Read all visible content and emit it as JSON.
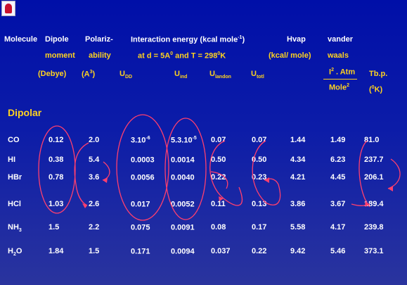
{
  "header": {
    "row1": {
      "molecule": "Molecule",
      "dipole": "Dipole",
      "polariz": "Polariz-",
      "interaction": "Interaction energy (kcal mole",
      "interaction_exp": "-1",
      "interaction_close": ")",
      "hvap": "Hvap",
      "vander": "vander"
    },
    "row2": {
      "moment": "moment",
      "ability": "ability",
      "at_d": "at d = 5A",
      "at_d_sup": "0",
      "and_t": " and T = 298",
      "and_t_sup": "0",
      "kelvin": "K",
      "kcal_mole": "(kcal/ mole)",
      "waals": "waals"
    },
    "row3": {
      "debye": "(Debye)",
      "a3": "(A",
      "a3_sup": "3",
      "a3_close": ")",
      "u": "U",
      "udd_sub": "DD",
      "uind_sub": "ind",
      "ulandon_sub": "landon",
      "utotl_sub": "totl",
      "frac_num": "I",
      "frac_num_sup": "2",
      "frac_num_rest": " . Atm",
      "frac_den": "Mole",
      "frac_den_sup": "2",
      "tbp": "Tb.p.",
      "tbp_unit_open": "(",
      "tbp_unit_sup": "0",
      "tbp_unit_rest": "K)"
    }
  },
  "section_title": "Dipolar",
  "rows": [
    {
      "molecule": "CO",
      "mol_sub": "",
      "mol_rest": "",
      "dipole": "0.12",
      "polar": "2.0",
      "udd": "3.10",
      "udd_sup": "-6",
      "uind": "5.3.10",
      "uind_sup": "-5",
      "ulandon": "0.07",
      "utotl": "0.07",
      "hvap": "1.44",
      "vdw": "1.49",
      "tbp": "81.0"
    },
    {
      "molecule": "HI",
      "mol_sub": "",
      "mol_rest": "",
      "dipole": "0.38",
      "polar": "5.4",
      "udd": "0.0003",
      "udd_sup": "",
      "uind": "0.0014",
      "uind_sup": "",
      "ulandon": "0.50",
      "utotl": "0.50",
      "hvap": "4.34",
      "vdw": "6.23",
      "tbp": "237.7"
    },
    {
      "molecule": "HBr",
      "mol_sub": "",
      "mol_rest": "",
      "dipole": "0.78",
      "polar": "3.6",
      "udd": "0.0056",
      "udd_sup": "",
      "uind": "0.0040",
      "uind_sup": "",
      "ulandon": "0.22",
      "utotl": "0.23",
      "hvap": "4.21",
      "vdw": "4.45",
      "tbp": "206.1"
    },
    {
      "molecule": "HCl",
      "mol_sub": "",
      "mol_rest": "",
      "dipole": "1.03",
      "polar": "2.6",
      "udd": "0.017",
      "udd_sup": "",
      "uind": "0.0052",
      "uind_sup": "",
      "ulandon": "0.11",
      "utotl": "0.13",
      "hvap": "3.86",
      "vdw": "3.67",
      "tbp": "189.4"
    },
    {
      "molecule": "NH",
      "mol_sub": "3",
      "mol_rest": "",
      "dipole": "1.5",
      "polar": "2.2",
      "udd": "0.075",
      "udd_sup": "",
      "uind": "0.0091",
      "uind_sup": "",
      "ulandon": "0.08",
      "utotl": "0.17",
      "hvap": "5.58",
      "vdw": "4.17",
      "tbp": "239.8"
    },
    {
      "molecule": "H",
      "mol_sub": "2",
      "mol_rest": "O",
      "dipole": "1.84",
      "polar": "1.5",
      "udd": "0.171",
      "udd_sup": "",
      "uind": "0.0094",
      "uind_sup": "",
      "ulandon": "0.037",
      "utotl": "0.22",
      "hvap": "9.42",
      "vdw": "5.46",
      "tbp": "373.1"
    }
  ],
  "colors": {
    "background": "#000fa8",
    "header_text": "#ffffff",
    "label_text": "#ffd21f",
    "annotation": "#ff3f6e"
  }
}
